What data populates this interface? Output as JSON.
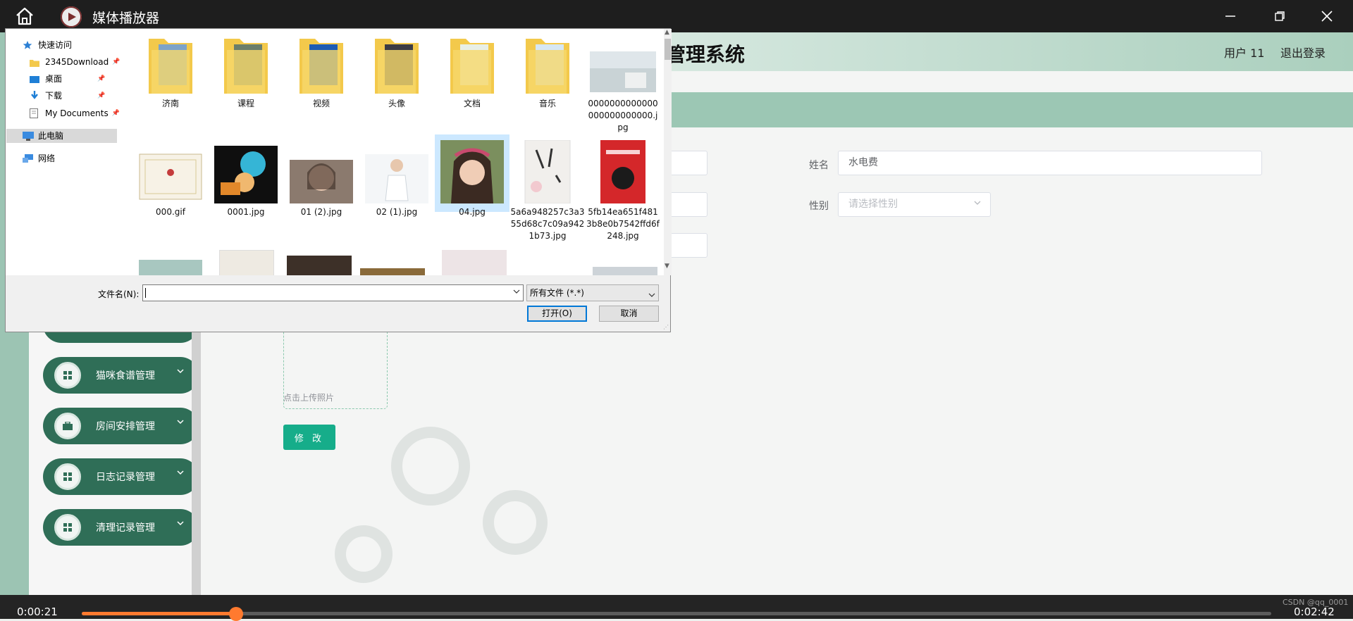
{
  "player": {
    "title": "媒体播放器",
    "current_time": "0:00:21",
    "total_time": "0:02:42",
    "progress": 0.13,
    "watermark": "CSDN @qq_0001"
  },
  "app": {
    "site_title": "管理系统",
    "user": "用户 11",
    "logout": "退出登录",
    "form": {
      "name_label": "姓名",
      "name_value": "水电费",
      "gender_label": "性别",
      "gender_placeholder": "请选择性别",
      "upload_hint": "点击上传照片",
      "modify_button": "修 改"
    },
    "menu": [
      {
        "label": "猫咪食谱管理",
        "icon": "grid-icon"
      },
      {
        "label": "房间安排管理",
        "icon": "briefcase-icon"
      },
      {
        "label": "日志记录管理",
        "icon": "grid-icon"
      },
      {
        "label": "清理记录管理",
        "icon": "grid-icon"
      }
    ],
    "accent_color": "#2f6e57"
  },
  "dialog": {
    "nav": {
      "quick_access": "快速访问",
      "items": [
        {
          "label": "2345Download",
          "pinned": true
        },
        {
          "label": "桌面",
          "pinned": true
        },
        {
          "label": "下载",
          "pinned": true
        },
        {
          "label": "My Documents",
          "pinned": true
        }
      ],
      "this_pc": "此电脑",
      "network": "网络"
    },
    "files": [
      {
        "name": "济南",
        "kind": "folder"
      },
      {
        "name": "课程",
        "kind": "folder"
      },
      {
        "name": "视频",
        "kind": "folder"
      },
      {
        "name": "头像",
        "kind": "folder"
      },
      {
        "name": "文档",
        "kind": "folder"
      },
      {
        "name": "音乐",
        "kind": "folder"
      },
      {
        "name": "0000000000000000000000000.jpg",
        "kind": "image"
      },
      {
        "name": "000.gif",
        "kind": "image"
      },
      {
        "name": "0001.jpg",
        "kind": "image"
      },
      {
        "name": "01 (2).jpg",
        "kind": "image"
      },
      {
        "name": "02 (1).jpg",
        "kind": "image"
      },
      {
        "name": "04.jpg",
        "kind": "image",
        "selected": true
      },
      {
        "name": "5a6a948257c3a355d68c7c09a9421b73.jpg",
        "kind": "image"
      },
      {
        "name": "5fb14ea651f4813b8e0b7542ffd6f248.jpg",
        "kind": "image"
      }
    ],
    "filename_label": "文件名(N):",
    "filename_value": "",
    "filetype": "所有文件 (*.*)",
    "open_button": "打开(O)",
    "cancel_button": "取消"
  }
}
